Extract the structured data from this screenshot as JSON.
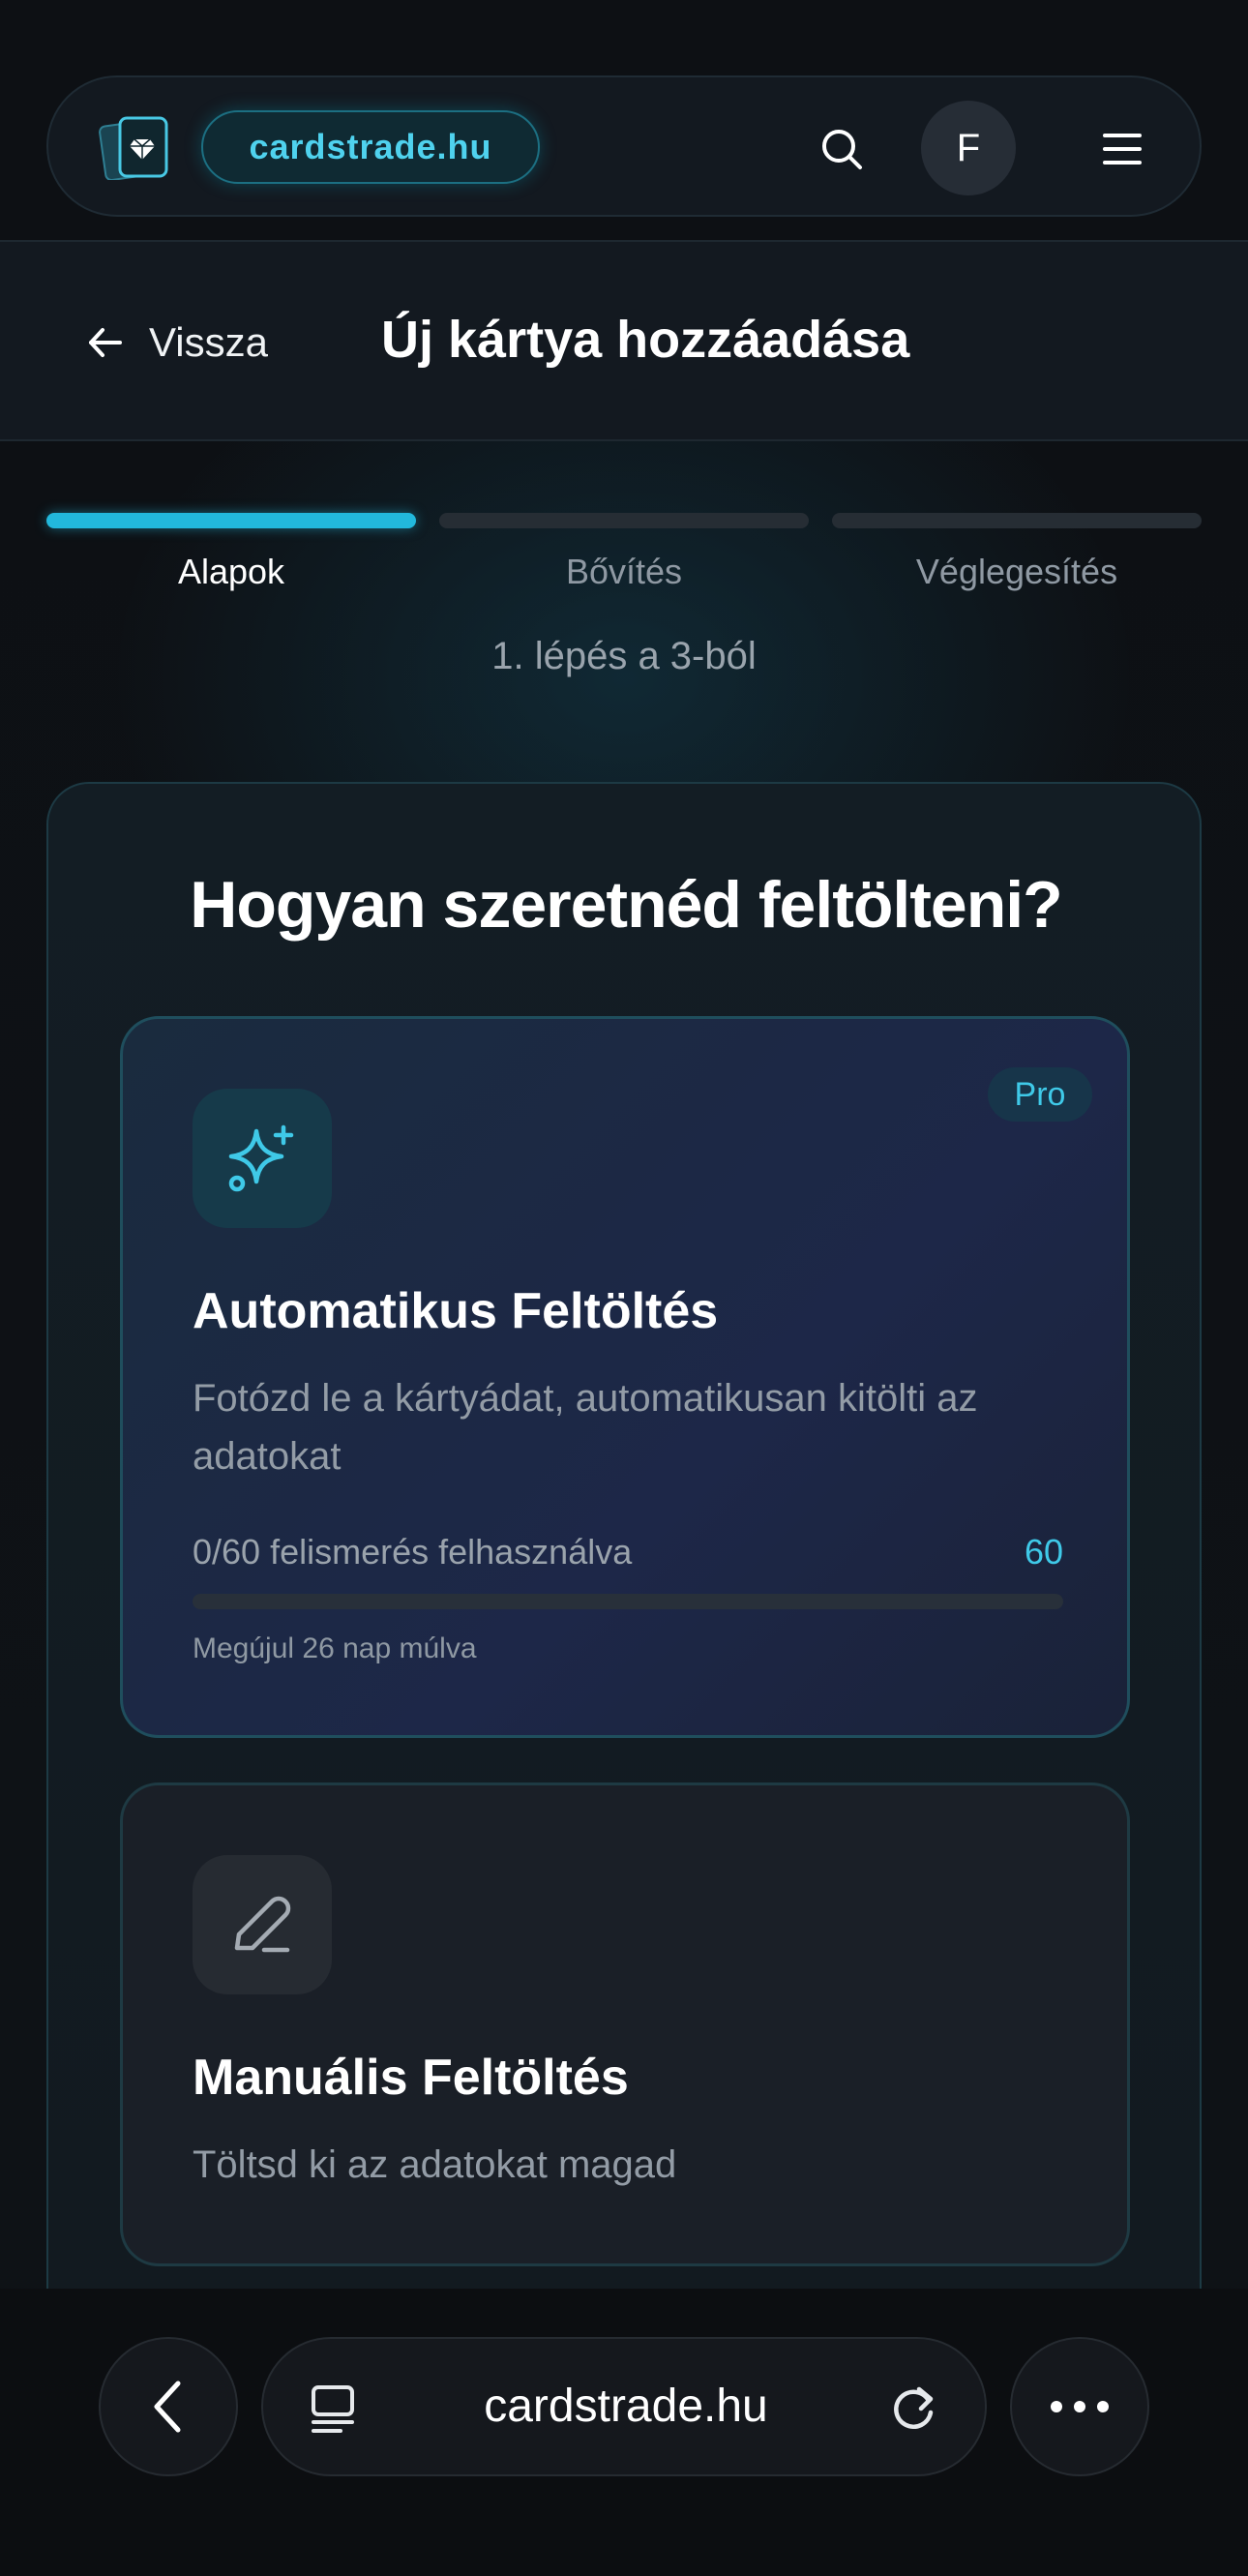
{
  "nav": {
    "brand": "cardstrade.hu",
    "avatar_initial": "F",
    "icons": {
      "logo": "card-diamond-icon",
      "search": "search-icon",
      "menu": "hamburger-icon"
    }
  },
  "header": {
    "back_label": "Vissza",
    "title": "Új kártya hozzáadása"
  },
  "steps": {
    "items": [
      {
        "label": "Alapok",
        "active": true
      },
      {
        "label": "Bővítés",
        "active": false
      },
      {
        "label": "Véglegesítés",
        "active": false
      }
    ],
    "counter": "1. lépés a 3-ból"
  },
  "main": {
    "heading": "Hogyan szeretnéd feltölteni?",
    "auto": {
      "badge": "Pro",
      "title": "Automatikus Feltöltés",
      "description": "Fotózd le a kártyádat, automatikusan kitölti az adatokat",
      "usage_text": "0/60 felismerés felhasználva",
      "usage_limit": "60",
      "usage_fraction": 0,
      "renew_text": "Megújul 26 nap múlva",
      "icon": "sparkles-icon"
    },
    "manual": {
      "title": "Manuális Feltöltés",
      "description": "Töltsd ki az adatokat magad",
      "icon": "pencil-icon"
    }
  },
  "browser": {
    "url": "cardstrade.hu"
  },
  "colors": {
    "accent": "#22b8dc",
    "background": "#0d1014"
  }
}
